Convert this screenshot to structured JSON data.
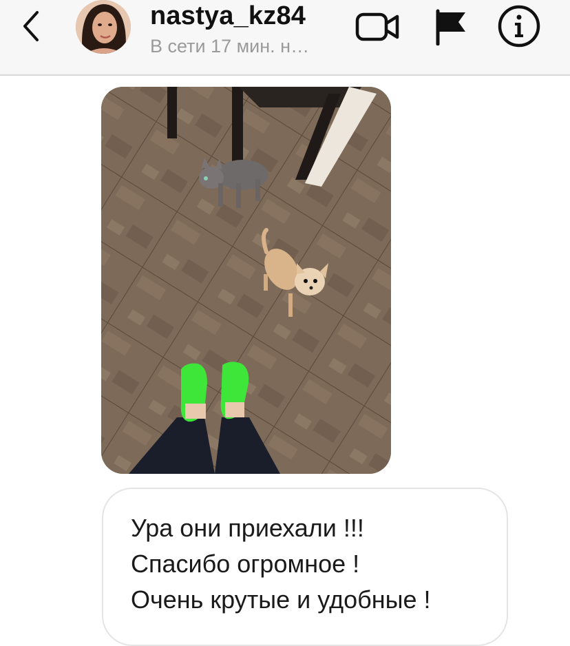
{
  "header": {
    "back_icon": "chevron-left-icon",
    "username": "nastya_kz84",
    "status": "В сети 17 мин. н…",
    "actions": [
      {
        "name": "video-call",
        "icon": "video-camera-icon"
      },
      {
        "name": "report",
        "icon": "flag-icon"
      },
      {
        "name": "details",
        "icon": "info-icon"
      }
    ]
  },
  "messages": [
    {
      "type": "photo",
      "description_icon": "photo-message"
    },
    {
      "type": "text",
      "lines": [
        "Ура они приехали !!!",
        "Спасибо огромное !",
        "Очень крутые и удобные !"
      ]
    }
  ],
  "colors": {
    "header_bg": "#f7f7f7",
    "status_text": "#9a9a9a",
    "bubble_border": "#e4e4e4",
    "shoe_green": "#3ee63a"
  }
}
